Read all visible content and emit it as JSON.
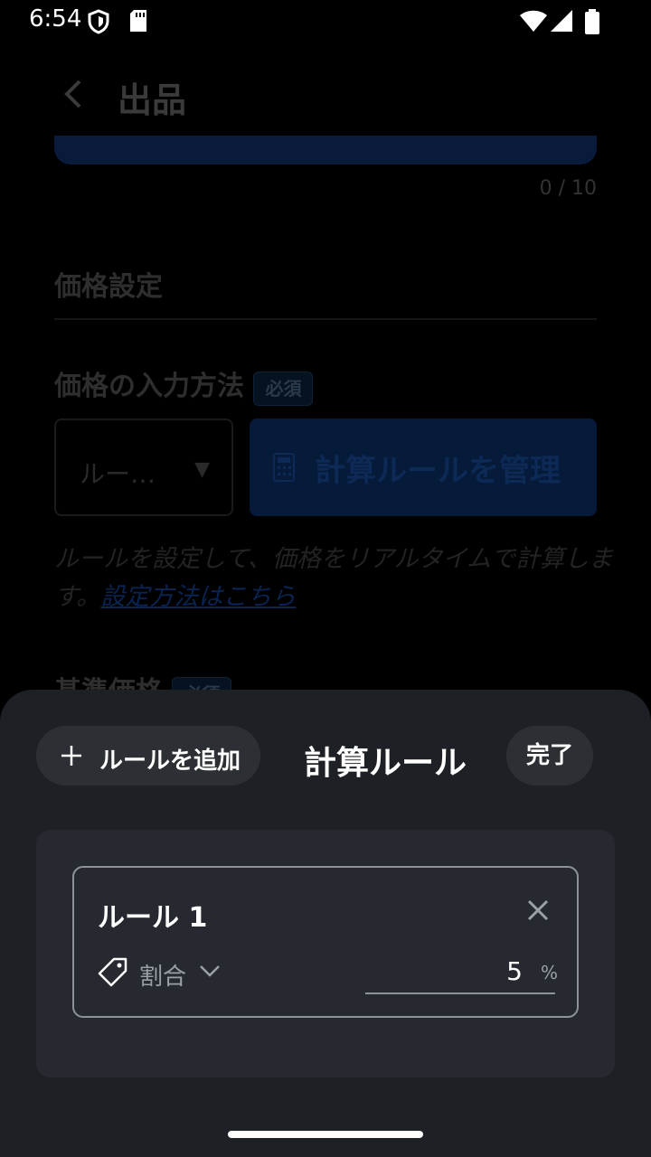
{
  "status_bar": {
    "time": "6:54"
  },
  "page": {
    "title": "出品",
    "char_count": "0 / 10",
    "section_title": "価格設定",
    "input_method_label": "価格の入力方法",
    "required_badge": "必須",
    "method_select_value": "ルー…",
    "manage_rules_label": "計算ルールを管理",
    "help_text": "ルールを設定して、価格をリアルタイムで計算します。",
    "help_link": "設定方法はこちら",
    "base_price_label": "基準価格",
    "base_price_badge": "必須"
  },
  "sheet": {
    "add_rule_label": "ルールを追加",
    "title": "計算ルール",
    "done_label": "完了",
    "rules": [
      {
        "name": "ルール 1",
        "type": "割合",
        "value": "5",
        "unit": "%"
      }
    ]
  }
}
